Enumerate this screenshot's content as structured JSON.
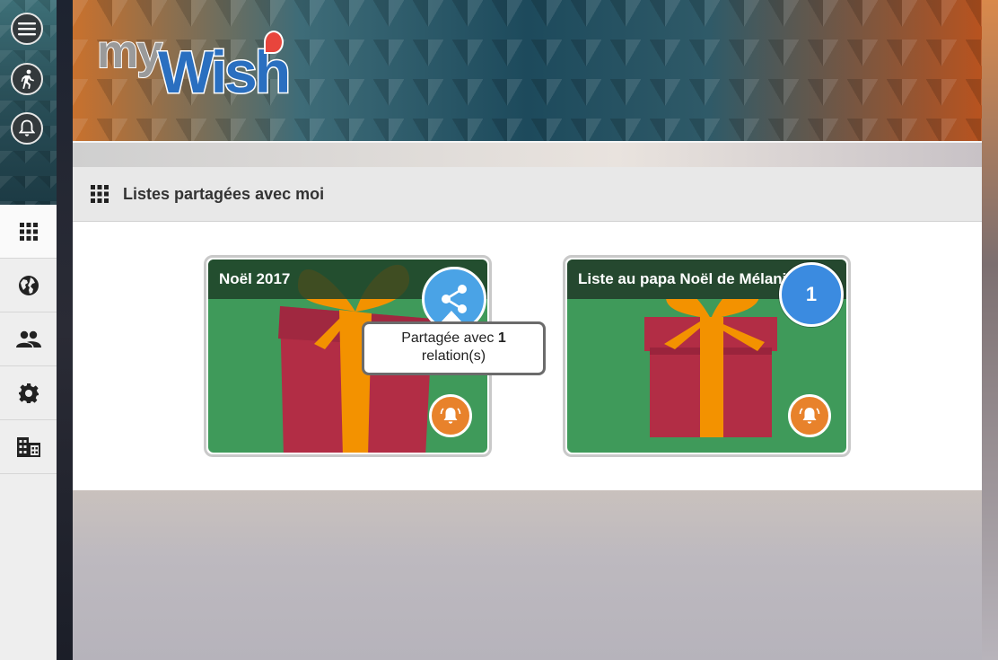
{
  "app": {
    "logo_my": "my",
    "logo_wish": "Wish"
  },
  "sidebar": {
    "top_buttons": [
      {
        "icon": "menu-icon"
      },
      {
        "icon": "running-person-icon"
      },
      {
        "icon": "bell-icon"
      }
    ],
    "items": [
      {
        "icon": "grid-icon",
        "active": true
      },
      {
        "icon": "globe-icon"
      },
      {
        "icon": "people-icon"
      },
      {
        "icon": "gear-icon"
      },
      {
        "icon": "building-icon"
      }
    ]
  },
  "panel": {
    "title": "Listes partagées avec moi",
    "title_icon": "grid-icon"
  },
  "cards": [
    {
      "title": "Noël 2017",
      "share_icon": "share-icon",
      "bell_icon": "bell-ringing-icon",
      "tooltip": {
        "prefix": "Partagée avec ",
        "count": "1",
        "suffix": "relation(s)"
      }
    },
    {
      "title": "Liste au papa Noël de Mélanie",
      "count_badge": "1",
      "bell_icon": "bell-ringing-icon"
    }
  ],
  "colors": {
    "card_green": "#3f9a5a",
    "card_header": "#25482f",
    "bell_orange": "#e8822b",
    "share_blue": "#4aa3e6",
    "gift_red": "#b22d45",
    "ribbon_orange": "#f39200"
  }
}
